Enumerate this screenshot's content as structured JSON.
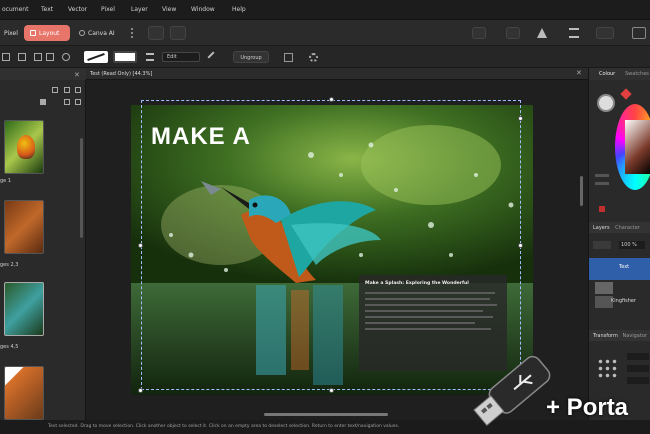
{
  "menubar": {
    "items": [
      "ocument",
      "Text",
      "Vector",
      "Pixel",
      "Layer",
      "View",
      "Window",
      "Help"
    ]
  },
  "personas": {
    "pixel": "Pixel",
    "layout": "Layout",
    "canva": "Canva AI"
  },
  "toolbar2": {
    "style_value": "Edit",
    "ungroup_label": "Ungroup"
  },
  "left_panel": {
    "pages": [
      {
        "label": "ge 1"
      },
      {
        "label": "ges 2,3"
      },
      {
        "label": "ges 4,5"
      }
    ]
  },
  "document": {
    "tab_title": "Test (Read Only) [44.3%]",
    "heading": "MAKE A",
    "text_block_title": "Make a Splash: Exploring the Wonderful",
    "accent": "#e8756a"
  },
  "right_panel": {
    "colour_tab": "Colour",
    "swatches_tab": "Swatches",
    "layers_tab": "Layers",
    "character_tab": "Character",
    "blend_value": "100 %",
    "layer_text": "Text",
    "layer_kingfisher": "Kingfisher",
    "transform_tab": "Transform",
    "navigator_tab": "Navigator"
  },
  "statusbar": {
    "text": "Text selected. Drag to move selection. Click another object to select it. Click on an empty area to deselect selection. Return to enter text/navigation values."
  },
  "overlay": {
    "portable_text": "+ Porta"
  }
}
